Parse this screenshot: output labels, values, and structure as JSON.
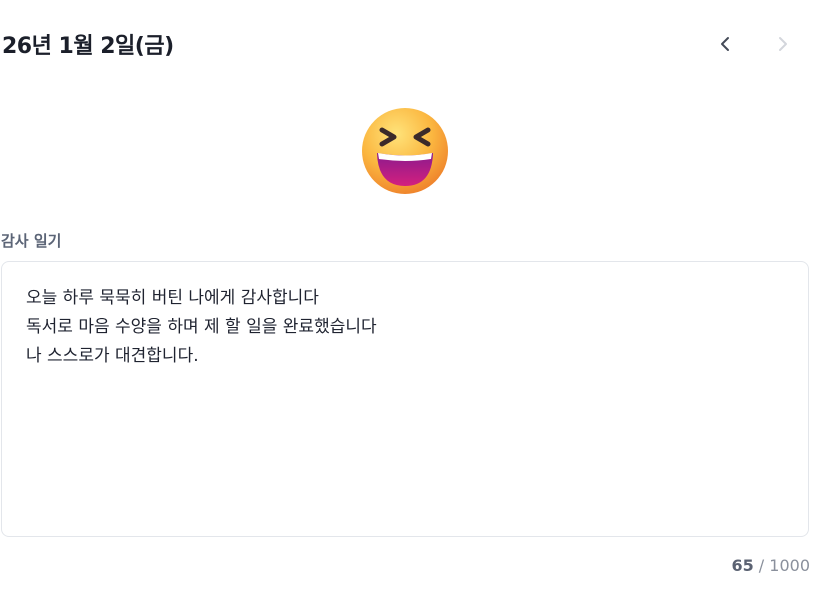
{
  "header": {
    "date_title": "26년 1월 2일(금)",
    "prev_icon": "chevron-left-icon",
    "next_icon": "chevron-right-icon"
  },
  "mood": {
    "icon": "grinning-squinting-face-emoji",
    "colors": {
      "face_top": "#ffd85c",
      "face_bottom": "#f08a2c",
      "mouth": "#b0178a"
    }
  },
  "diary": {
    "label": "감사 일기",
    "lines": [
      "오늘 하루 묵묵히 버틴 나에게 감사합니다",
      "독서로 마음 수양을 하며 제 할 일을 완료했습니다",
      "나 스스로가 대견합니다."
    ]
  },
  "counter": {
    "current": "65",
    "separator": " / ",
    "max": "1000"
  },
  "colors": {
    "text_primary": "#1f2330",
    "label": "#5b6476",
    "border": "#e3e6eb",
    "muted": "#8a909c"
  }
}
